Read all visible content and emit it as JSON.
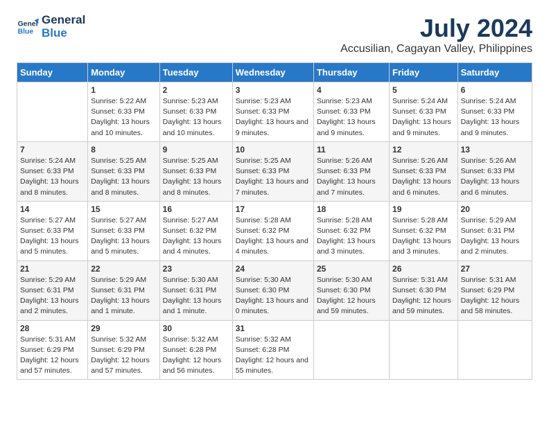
{
  "logo": {
    "line1": "General",
    "line2": "Blue"
  },
  "title": "July 2024",
  "subtitle": "Accusilian, Cagayan Valley, Philippines",
  "colors": {
    "header_bg": "#2878c8",
    "header_text": "#ffffff",
    "title_color": "#1a3a5c"
  },
  "days_of_week": [
    "Sunday",
    "Monday",
    "Tuesday",
    "Wednesday",
    "Thursday",
    "Friday",
    "Saturday"
  ],
  "weeks": [
    [
      {
        "num": "",
        "sunrise": "",
        "sunset": "",
        "daylight": ""
      },
      {
        "num": "1",
        "sunrise": "Sunrise: 5:22 AM",
        "sunset": "Sunset: 6:33 PM",
        "daylight": "Daylight: 13 hours and 10 minutes."
      },
      {
        "num": "2",
        "sunrise": "Sunrise: 5:23 AM",
        "sunset": "Sunset: 6:33 PM",
        "daylight": "Daylight: 13 hours and 10 minutes."
      },
      {
        "num": "3",
        "sunrise": "Sunrise: 5:23 AM",
        "sunset": "Sunset: 6:33 PM",
        "daylight": "Daylight: 13 hours and 9 minutes."
      },
      {
        "num": "4",
        "sunrise": "Sunrise: 5:23 AM",
        "sunset": "Sunset: 6:33 PM",
        "daylight": "Daylight: 13 hours and 9 minutes."
      },
      {
        "num": "5",
        "sunrise": "Sunrise: 5:24 AM",
        "sunset": "Sunset: 6:33 PM",
        "daylight": "Daylight: 13 hours and 9 minutes."
      },
      {
        "num": "6",
        "sunrise": "Sunrise: 5:24 AM",
        "sunset": "Sunset: 6:33 PM",
        "daylight": "Daylight: 13 hours and 9 minutes."
      }
    ],
    [
      {
        "num": "7",
        "sunrise": "Sunrise: 5:24 AM",
        "sunset": "Sunset: 6:33 PM",
        "daylight": "Daylight: 13 hours and 8 minutes."
      },
      {
        "num": "8",
        "sunrise": "Sunrise: 5:25 AM",
        "sunset": "Sunset: 6:33 PM",
        "daylight": "Daylight: 13 hours and 8 minutes."
      },
      {
        "num": "9",
        "sunrise": "Sunrise: 5:25 AM",
        "sunset": "Sunset: 6:33 PM",
        "daylight": "Daylight: 13 hours and 8 minutes."
      },
      {
        "num": "10",
        "sunrise": "Sunrise: 5:25 AM",
        "sunset": "Sunset: 6:33 PM",
        "daylight": "Daylight: 13 hours and 7 minutes."
      },
      {
        "num": "11",
        "sunrise": "Sunrise: 5:26 AM",
        "sunset": "Sunset: 6:33 PM",
        "daylight": "Daylight: 13 hours and 7 minutes."
      },
      {
        "num": "12",
        "sunrise": "Sunrise: 5:26 AM",
        "sunset": "Sunset: 6:33 PM",
        "daylight": "Daylight: 13 hours and 6 minutes."
      },
      {
        "num": "13",
        "sunrise": "Sunrise: 5:26 AM",
        "sunset": "Sunset: 6:33 PM",
        "daylight": "Daylight: 13 hours and 6 minutes."
      }
    ],
    [
      {
        "num": "14",
        "sunrise": "Sunrise: 5:27 AM",
        "sunset": "Sunset: 6:33 PM",
        "daylight": "Daylight: 13 hours and 5 minutes."
      },
      {
        "num": "15",
        "sunrise": "Sunrise: 5:27 AM",
        "sunset": "Sunset: 6:33 PM",
        "daylight": "Daylight: 13 hours and 5 minutes."
      },
      {
        "num": "16",
        "sunrise": "Sunrise: 5:27 AM",
        "sunset": "Sunset: 6:32 PM",
        "daylight": "Daylight: 13 hours and 4 minutes."
      },
      {
        "num": "17",
        "sunrise": "Sunrise: 5:28 AM",
        "sunset": "Sunset: 6:32 PM",
        "daylight": "Daylight: 13 hours and 4 minutes."
      },
      {
        "num": "18",
        "sunrise": "Sunrise: 5:28 AM",
        "sunset": "Sunset: 6:32 PM",
        "daylight": "Daylight: 13 hours and 3 minutes."
      },
      {
        "num": "19",
        "sunrise": "Sunrise: 5:28 AM",
        "sunset": "Sunset: 6:32 PM",
        "daylight": "Daylight: 13 hours and 3 minutes."
      },
      {
        "num": "20",
        "sunrise": "Sunrise: 5:29 AM",
        "sunset": "Sunset: 6:31 PM",
        "daylight": "Daylight: 13 hours and 2 minutes."
      }
    ],
    [
      {
        "num": "21",
        "sunrise": "Sunrise: 5:29 AM",
        "sunset": "Sunset: 6:31 PM",
        "daylight": "Daylight: 13 hours and 2 minutes."
      },
      {
        "num": "22",
        "sunrise": "Sunrise: 5:29 AM",
        "sunset": "Sunset: 6:31 PM",
        "daylight": "Daylight: 13 hours and 1 minute."
      },
      {
        "num": "23",
        "sunrise": "Sunrise: 5:30 AM",
        "sunset": "Sunset: 6:31 PM",
        "daylight": "Daylight: 13 hours and 1 minute."
      },
      {
        "num": "24",
        "sunrise": "Sunrise: 5:30 AM",
        "sunset": "Sunset: 6:30 PM",
        "daylight": "Daylight: 13 hours and 0 minutes."
      },
      {
        "num": "25",
        "sunrise": "Sunrise: 5:30 AM",
        "sunset": "Sunset: 6:30 PM",
        "daylight": "Daylight: 12 hours and 59 minutes."
      },
      {
        "num": "26",
        "sunrise": "Sunrise: 5:31 AM",
        "sunset": "Sunset: 6:30 PM",
        "daylight": "Daylight: 12 hours and 59 minutes."
      },
      {
        "num": "27",
        "sunrise": "Sunrise: 5:31 AM",
        "sunset": "Sunset: 6:29 PM",
        "daylight": "Daylight: 12 hours and 58 minutes."
      }
    ],
    [
      {
        "num": "28",
        "sunrise": "Sunrise: 5:31 AM",
        "sunset": "Sunset: 6:29 PM",
        "daylight": "Daylight: 12 hours and 57 minutes."
      },
      {
        "num": "29",
        "sunrise": "Sunrise: 5:32 AM",
        "sunset": "Sunset: 6:29 PM",
        "daylight": "Daylight: 12 hours and 57 minutes."
      },
      {
        "num": "30",
        "sunrise": "Sunrise: 5:32 AM",
        "sunset": "Sunset: 6:28 PM",
        "daylight": "Daylight: 12 hours and 56 minutes."
      },
      {
        "num": "31",
        "sunrise": "Sunrise: 5:32 AM",
        "sunset": "Sunset: 6:28 PM",
        "daylight": "Daylight: 12 hours and 55 minutes."
      },
      {
        "num": "",
        "sunrise": "",
        "sunset": "",
        "daylight": ""
      },
      {
        "num": "",
        "sunrise": "",
        "sunset": "",
        "daylight": ""
      },
      {
        "num": "",
        "sunrise": "",
        "sunset": "",
        "daylight": ""
      }
    ]
  ]
}
